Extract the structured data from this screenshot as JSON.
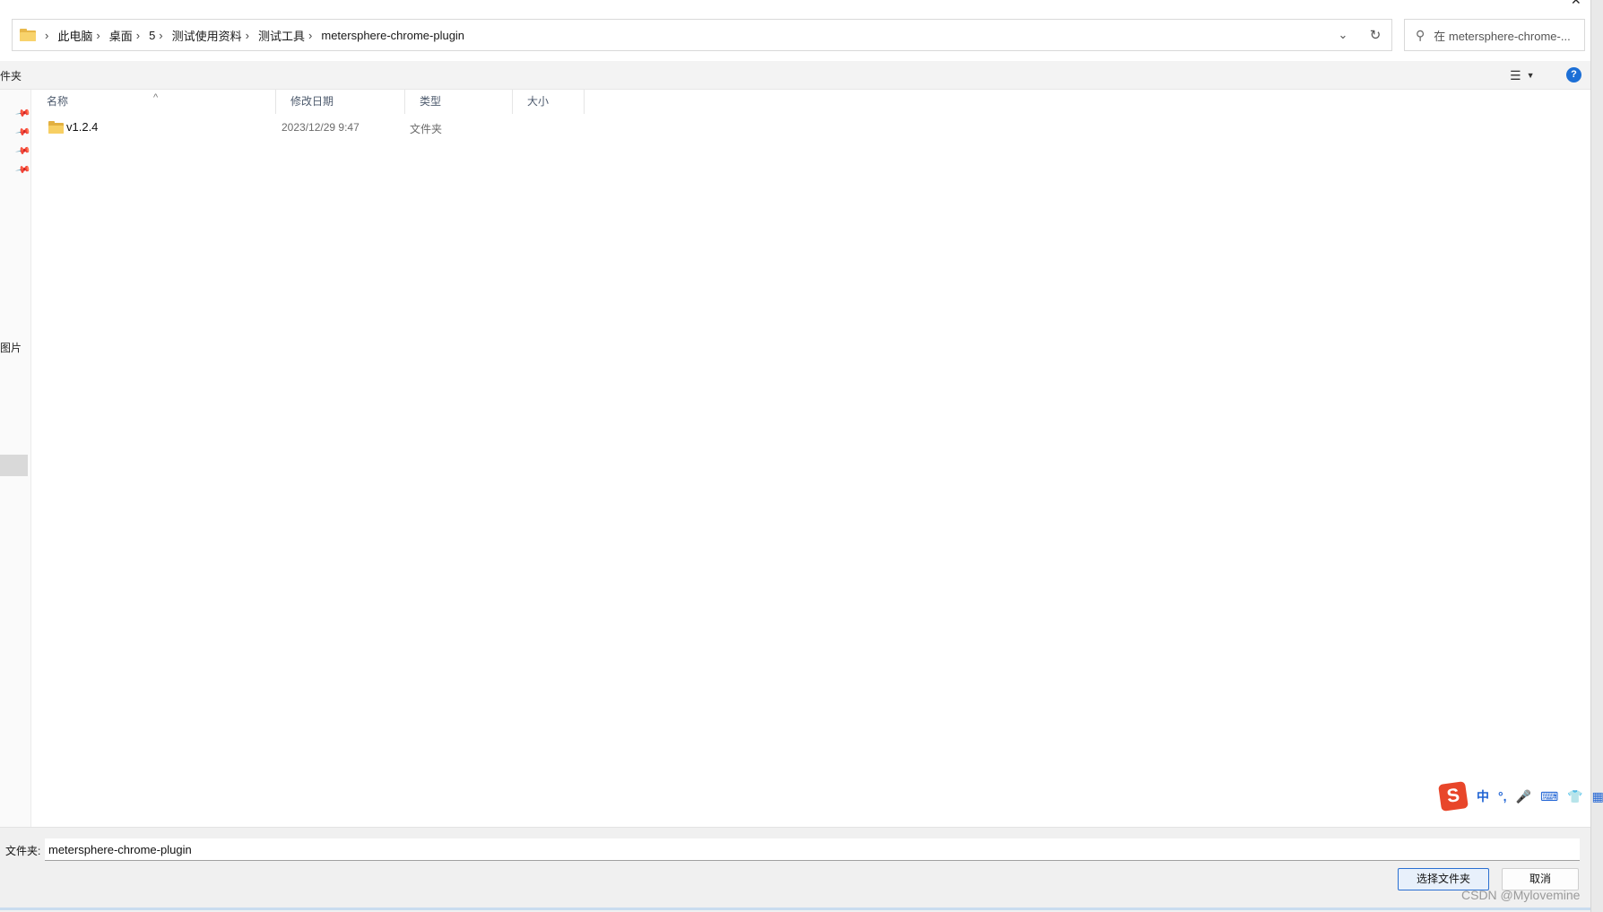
{
  "address": {
    "breadcrumbs": [
      "此电脑",
      "桌面",
      "5",
      "测试使用资料",
      "测试工具",
      "metersphere-chrome-plugin"
    ],
    "separator": "›",
    "dropdown_icon": "chevron-down-icon",
    "refresh_icon": "refresh-icon"
  },
  "search": {
    "placeholder": "在 metersphere-chrome-..."
  },
  "toolbar": {
    "left_label": "件夹",
    "view_icon": "view-options-icon",
    "help_label": "?"
  },
  "nav": {
    "label2": "图片",
    "pins": [
      "pin-icon",
      "pin-icon",
      "pin-icon",
      "pin-icon"
    ]
  },
  "columns": {
    "name": "名称",
    "date": "修改日期",
    "type": "类型",
    "size": "大小",
    "sort_indicator": "^"
  },
  "files": [
    {
      "name": "v1.2.4",
      "date": "2023/12/29 9:47",
      "type": "文件夹",
      "size": ""
    }
  ],
  "ime": {
    "logo": "S",
    "items": [
      "中",
      "°,",
      "🎤",
      "⌨",
      "👕",
      "▦"
    ]
  },
  "bottom": {
    "folder_label": "文件夹:",
    "folder_value": "metersphere-chrome-plugin",
    "select_button": "选择文件夹",
    "cancel_button": "取消"
  },
  "watermark": "CSDN @Mylovemine",
  "colors": {
    "accent": "#1c6fd6",
    "folder": "#f7cf63",
    "ime_logo": "#e8462a"
  }
}
